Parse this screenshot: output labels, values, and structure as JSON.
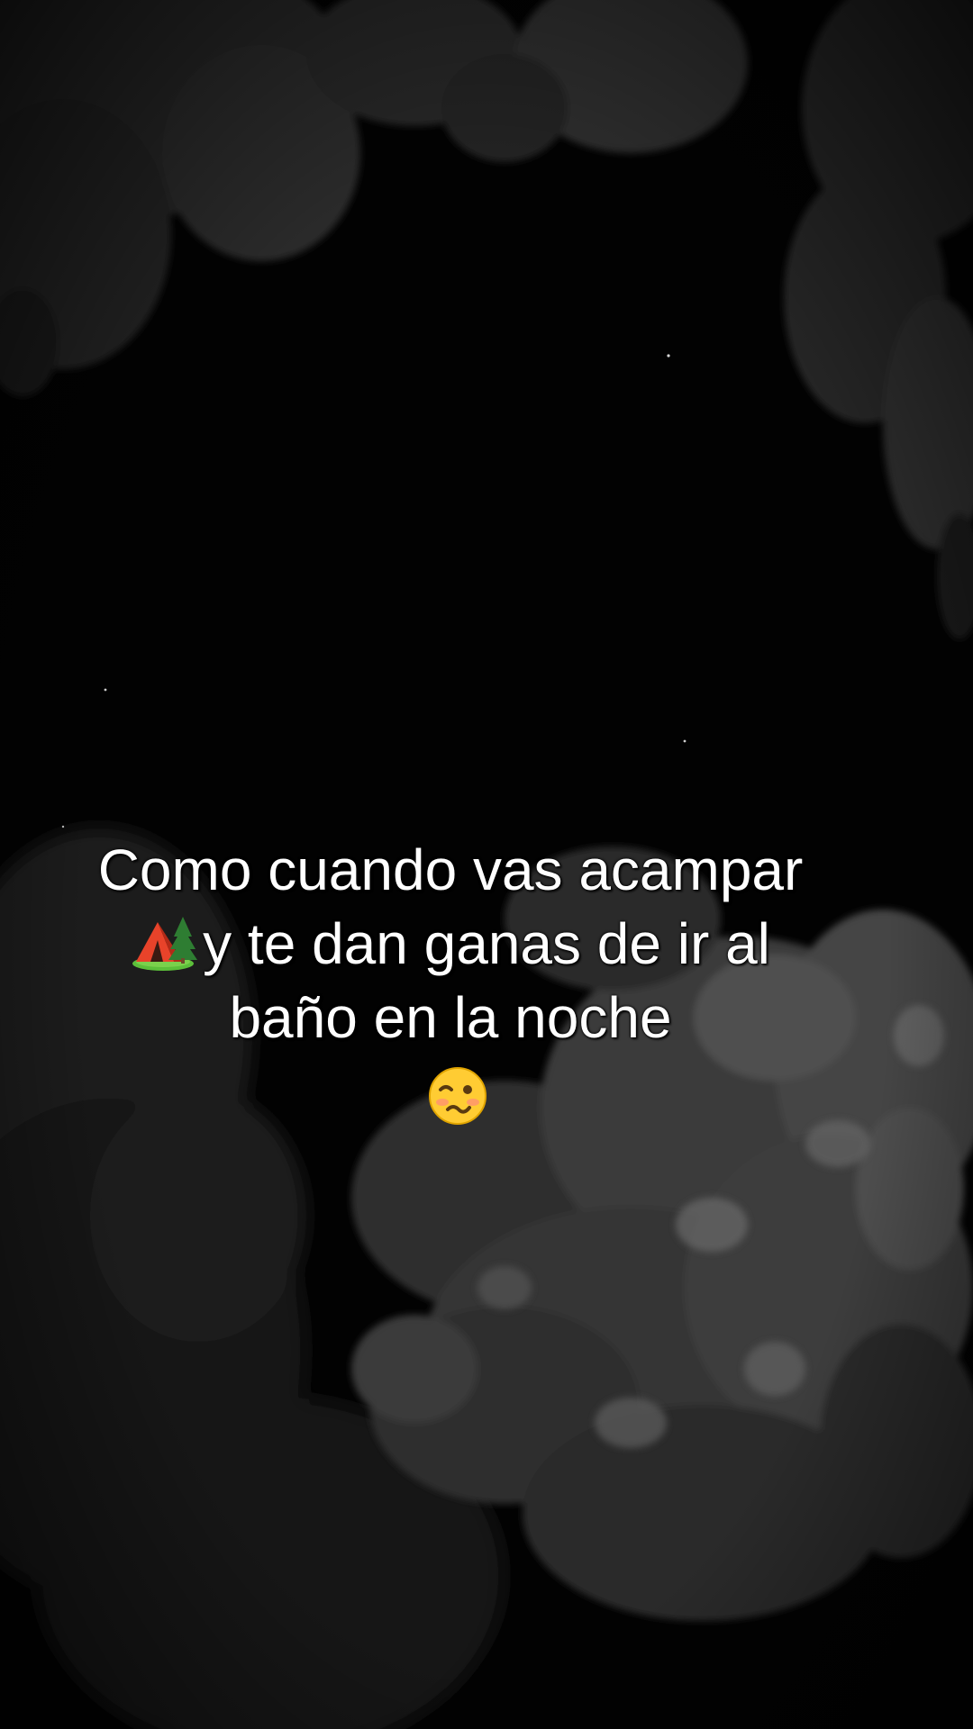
{
  "caption": {
    "line1": "Como cuando vas acampar",
    "line2_emoji": "camping-tent-tree-emoji",
    "line2_text": "y te dan ganas de ir al",
    "line3": "baño en la noche",
    "line4_emoji": "woozy-face-emoji"
  },
  "colors": {
    "background": "#020202",
    "foliage_dark": "#1e1e1e",
    "foliage_mid": "#3a3a3a",
    "foliage_light": "#6a6a6a",
    "caption_text": "#ffffff"
  }
}
